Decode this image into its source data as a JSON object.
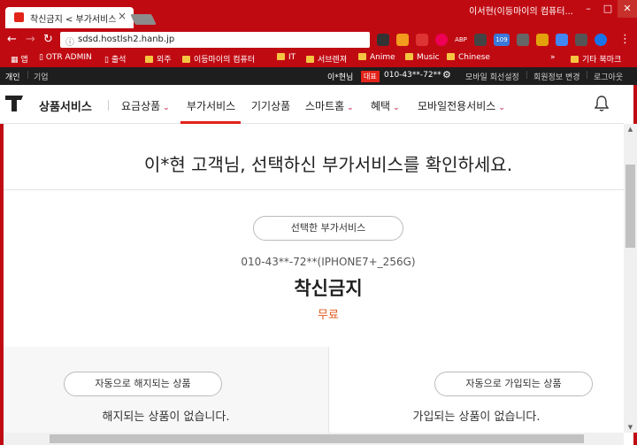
{
  "browser": {
    "tab_title": "착신금지 < 부가서비스",
    "tab_close": "×",
    "window_title": "이서현(이등마이의 컴퓨터...",
    "controls": [
      "–",
      "□",
      "✕"
    ],
    "url": "sdsd.hostlsh2.hanb.jp",
    "extension_badge": "109",
    "ext_abp": "ABP",
    "bookmarks": [
      {
        "label": "앱",
        "type": "apps"
      },
      {
        "label": "OTR ADMIN",
        "type": "page"
      },
      {
        "label": "출석",
        "type": "page"
      },
      {
        "label": "외주",
        "type": "folder"
      },
      {
        "label": "이등마이의 컴퓨터",
        "type": "folder"
      },
      {
        "label": "IT",
        "type": "folder"
      },
      {
        "label": "서브렌져",
        "type": "folder"
      },
      {
        "label": "Anime",
        "type": "folder"
      },
      {
        "label": "Music",
        "type": "folder"
      },
      {
        "label": "Chinese",
        "type": "folder"
      }
    ],
    "bookmarks_more": "»",
    "other_bookmarks": "기타 북마크"
  },
  "site_top": {
    "left_items": [
      "개인",
      "기업"
    ],
    "user_name": "이*현님",
    "badge": "대표",
    "phone": "010-43**-72**",
    "right_links": [
      "모바일 회선설정",
      "회원정보 변경",
      "로그아웃"
    ]
  },
  "site_nav": {
    "title": "상품서비스",
    "items": [
      {
        "label": "요금상품",
        "dropdown": true
      },
      {
        "label": "부가서비스",
        "dropdown": false,
        "active": true
      },
      {
        "label": "기기상품",
        "dropdown": false
      },
      {
        "label": "스마트홈",
        "dropdown": true
      },
      {
        "label": "혜택",
        "dropdown": true
      },
      {
        "label": "모바일전용서비스",
        "dropdown": true
      }
    ],
    "chevron": "⌄"
  },
  "main": {
    "heading": "이*현 고객님, 선택하신 부가서비스를 확인하세요.",
    "selected_button": "선택한 부가서비스",
    "device_line": "010-43**-72**(IPHONE7+_256G)",
    "service_name": "착신금지",
    "service_price": "무료",
    "left_panel": {
      "button": "자동으로 해지되는 상품",
      "message": "해지되는 상품이 없습니다."
    },
    "right_panel": {
      "button": "자동으로 가입되는 상품",
      "message": "가입되는 상품이 없습니다."
    }
  },
  "colors": {
    "brand_red": "#e2231a",
    "chrome_red": "#c00a12",
    "price_orange": "#e25a1c"
  }
}
